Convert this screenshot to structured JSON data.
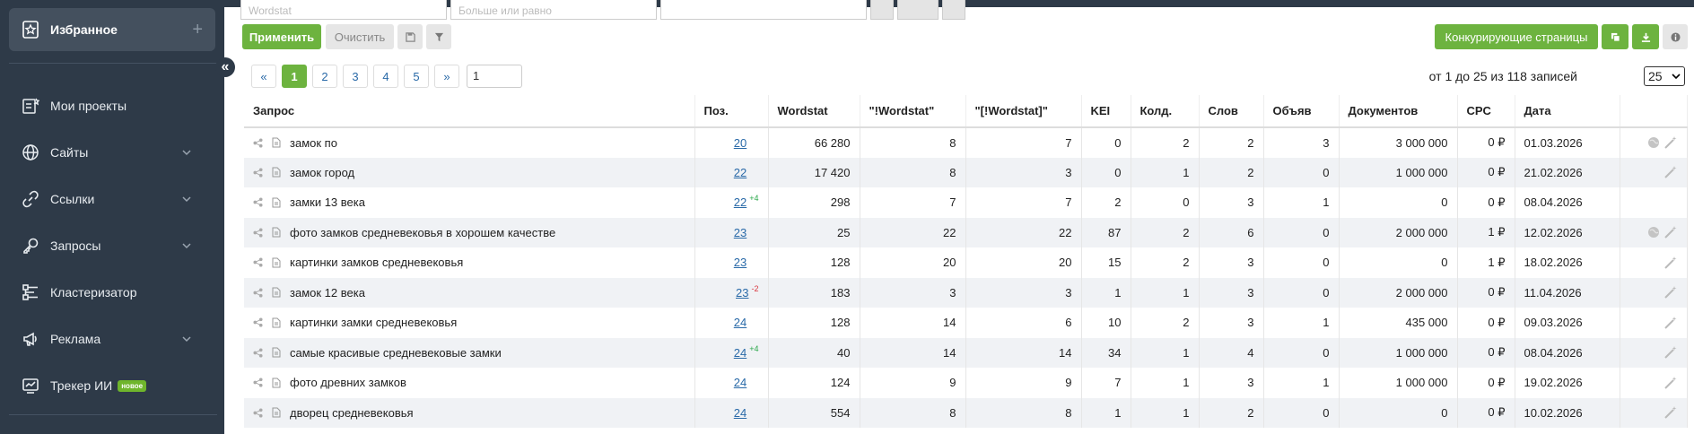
{
  "sidebar": {
    "favorites_label": "Избранное",
    "items": [
      {
        "label": "Мои проекты",
        "icon": "projects-icon",
        "has_chevron": false
      },
      {
        "label": "Сайты",
        "icon": "globe-icon",
        "has_chevron": true
      },
      {
        "label": "Ссылки",
        "icon": "link-icon",
        "has_chevron": true
      },
      {
        "label": "Запросы",
        "icon": "key-icon",
        "has_chevron": true
      },
      {
        "label": "Кластеризатор",
        "icon": "cluster-icon",
        "has_chevron": false
      },
      {
        "label": "Реклама",
        "icon": "megaphone-icon",
        "has_chevron": true
      },
      {
        "label": "Трекер ИИ",
        "icon": "tracker-icon",
        "has_chevron": false,
        "badge": "новое"
      }
    ]
  },
  "filters": {
    "wordstat_placeholder": "Wordstat",
    "more_or_equal_placeholder": "Больше или равно"
  },
  "toolbar": {
    "apply_label": "Применить",
    "clear_label": "Очистить",
    "competing_pages_label": "Конкурирующие страницы"
  },
  "pagination": {
    "prev": "«",
    "pages": [
      "1",
      "2",
      "3",
      "4",
      "5"
    ],
    "next": "»",
    "active": "1",
    "goto_value": "1"
  },
  "records_text": "от 1 до 25 из 118 записей",
  "per_page": "25",
  "table": {
    "headers": [
      "Запрос",
      "Поз.",
      "Wordstat",
      "\"!Wordstat\"",
      "\"[!Wordstat]\"",
      "KEI",
      "Колд.",
      "Слов",
      "Объяв",
      "Документов",
      "CPC",
      "Дата",
      ""
    ],
    "rows": [
      {
        "query": "замок по",
        "pos": "20",
        "delta": "",
        "ws": "66 280",
        "ws2": "8",
        "ws3": "7",
        "kei": "0",
        "kold": "2",
        "words": "2",
        "ads": "3",
        "docs": "3 000 000",
        "cpc": "0 ₽",
        "date": "01.03.2026",
        "globe": true
      },
      {
        "query": "замок город",
        "pos": "22",
        "delta": "",
        "ws": "17 420",
        "ws2": "8",
        "ws3": "3",
        "kei": "0",
        "kold": "1",
        "words": "2",
        "ads": "0",
        "docs": "1 000 000",
        "cpc": "0 ₽",
        "date": "21.02.2026",
        "globe": false
      },
      {
        "query": "замки 13 века",
        "pos": "22",
        "delta": "+4",
        "ws": "298",
        "ws2": "7",
        "ws3": "7",
        "kei": "2",
        "kold": "0",
        "words": "3",
        "ads": "1",
        "docs": "0",
        "cpc": "0 ₽",
        "date": "08.04.2026",
        "globe": false,
        "no_wand": true
      },
      {
        "query": "фото замков средневековья в хорошем качестве",
        "pos": "23",
        "delta": "",
        "ws": "25",
        "ws2": "22",
        "ws3": "22",
        "kei": "87",
        "kold": "2",
        "words": "6",
        "ads": "0",
        "docs": "2 000 000",
        "cpc": "1 ₽",
        "date": "12.02.2026",
        "globe": true
      },
      {
        "query": "картинки замков средневековья",
        "pos": "23",
        "delta": "",
        "ws": "128",
        "ws2": "20",
        "ws3": "20",
        "kei": "15",
        "kold": "2",
        "words": "3",
        "ads": "0",
        "docs": "0",
        "cpc": "1 ₽",
        "date": "18.02.2026",
        "globe": false
      },
      {
        "query": "замок 12 века",
        "pos": "23",
        "delta": "-2",
        "ws": "183",
        "ws2": "3",
        "ws3": "3",
        "kei": "1",
        "kold": "1",
        "words": "3",
        "ads": "0",
        "docs": "2 000 000",
        "cpc": "0 ₽",
        "date": "11.04.2026",
        "globe": false
      },
      {
        "query": "картинки замки средневековья",
        "pos": "24",
        "delta": "",
        "ws": "128",
        "ws2": "14",
        "ws3": "6",
        "kei": "10",
        "kold": "2",
        "words": "3",
        "ads": "1",
        "docs": "435 000",
        "cpc": "0 ₽",
        "date": "09.03.2026",
        "globe": false
      },
      {
        "query": "самые красивые средневековые замки",
        "pos": "24",
        "delta": "+4",
        "ws": "40",
        "ws2": "14",
        "ws3": "14",
        "kei": "34",
        "kold": "1",
        "words": "4",
        "ads": "0",
        "docs": "1 000 000",
        "cpc": "0 ₽",
        "date": "08.04.2026",
        "globe": false
      },
      {
        "query": "фото древних замков",
        "pos": "24",
        "delta": "",
        "ws": "124",
        "ws2": "9",
        "ws3": "9",
        "kei": "7",
        "kold": "1",
        "words": "3",
        "ads": "1",
        "docs": "1 000 000",
        "cpc": "0 ₽",
        "date": "19.02.2026",
        "globe": false
      },
      {
        "query": "дворец средневековья",
        "pos": "24",
        "delta": "",
        "ws": "554",
        "ws2": "8",
        "ws3": "8",
        "kei": "1",
        "kold": "1",
        "words": "2",
        "ads": "0",
        "docs": "0",
        "cpc": "0 ₽",
        "date": "10.02.2026",
        "globe": false
      }
    ]
  },
  "colors": {
    "sidebar_bg": "#2e3a48",
    "accent_green": "#6db33f",
    "link_blue": "#2a6aa8"
  }
}
